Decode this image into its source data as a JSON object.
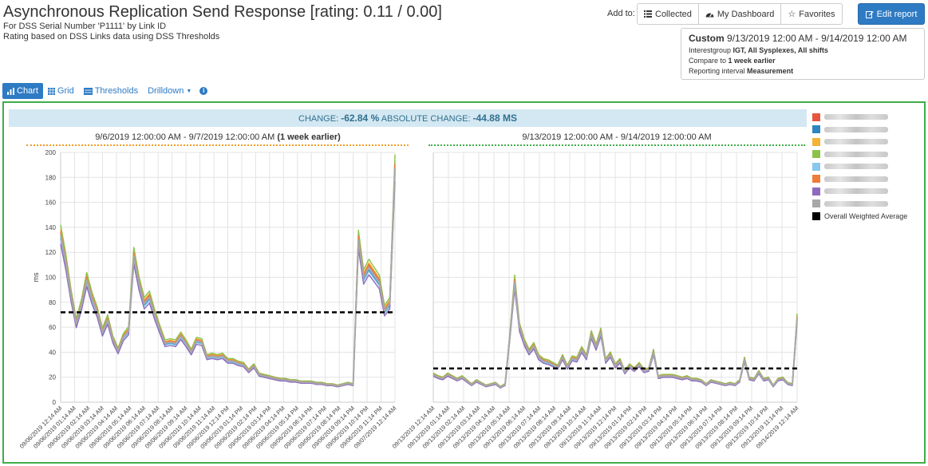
{
  "header": {
    "title": "Asynchronous Replication Send Response [rating: 0.11 / 0.00]",
    "subtitle1": "For DSS Serial Number 'P1111' by Link ID",
    "subtitle2": "Rating based on DSS Links data using DSS Thresholds"
  },
  "toolbar": {
    "add_to_label": "Add to:",
    "collected_label": "Collected",
    "dashboard_label": "My Dashboard",
    "favorites_label": "Favorites",
    "edit_label": "Edit report"
  },
  "info": {
    "range_prefix": "Custom",
    "range_value": "9/13/2019 12:00 AM - 9/14/2019 12:00 AM",
    "line1_prefix": "Interestgroup ",
    "line1_bold": "IGT, All Sysplexes, All shifts",
    "line2_prefix": "Compare to ",
    "line2_bold": "1 week earlier",
    "line3_prefix": "Reporting interval ",
    "line3_bold": "Measurement"
  },
  "tabs": {
    "chart": "Chart",
    "grid": "Grid",
    "thresholds": "Thresholds",
    "drilldown": "Drilldown"
  },
  "change": {
    "label": "CHANGE:",
    "value": "-62.84 %",
    "abs_label": "ABSOLUTE CHANGE:",
    "abs_value": "-44.88 MS"
  },
  "colors": {
    "accent": "#2e7bc4",
    "frame": "#3fae49",
    "left_rule": "#f39c2c",
    "right_rule": "#3fae49"
  },
  "legend": {
    "items": [
      {
        "color": "#e8553e",
        "label": ""
      },
      {
        "color": "#2e86c1",
        "label": ""
      },
      {
        "color": "#f5b335",
        "label": ""
      },
      {
        "color": "#8bc34a",
        "label": ""
      },
      {
        "color": "#87c7ee",
        "label": ""
      },
      {
        "color": "#f07c3a",
        "label": ""
      },
      {
        "color": "#8e6bbf",
        "label": ""
      },
      {
        "color": "#a8a8a8",
        "label": ""
      },
      {
        "color": "#000000",
        "label": "Overall Weighted Average"
      }
    ]
  },
  "chart_data": [
    {
      "type": "line",
      "title": "9/6/2019 12:00:00 AM - 9/7/2019 12:00:00 AM",
      "title_suffix": "(1 week earlier)",
      "ylabel": "ms",
      "ylim": [
        0,
        200
      ],
      "yticks": [
        0,
        20,
        40,
        60,
        80,
        100,
        120,
        140,
        160,
        180,
        200
      ],
      "grid": true,
      "x_tick_labels": [
        "09/06/2019 12:14 AM",
        "09/06/2019 01:14 AM",
        "09/06/2019 02:14 AM",
        "09/06/2019 03:14 AM",
        "09/06/2019 04:14 AM",
        "09/06/2019 05:14 AM",
        "09/06/2019 06:14 AM",
        "09/06/2019 07:14 AM",
        "09/06/2019 08:14 AM",
        "09/06/2019 09:14 AM",
        "09/06/2019 10:14 AM",
        "09/06/2019 11:14 AM",
        "09/06/2019 12:14 PM",
        "09/06/2019 01:14 PM",
        "09/06/2019 02:14 PM",
        "09/06/2019 03:14 PM",
        "09/06/2019 04:14 PM",
        "09/06/2019 05:14 PM",
        "09/06/2019 06:14 PM",
        "09/06/2019 07:14 PM",
        "09/06/2019 08:14 PM",
        "09/06/2019 09:14 PM",
        "09/06/2019 10:14 PM",
        "09/06/2019 11:14 PM",
        "09/07/2019 12:14 AM"
      ],
      "average": 72,
      "series_values": [
        134,
        112,
        85,
        63,
        78,
        98,
        83,
        72,
        56,
        66,
        50,
        41,
        52,
        57,
        117,
        95,
        79,
        84,
        70,
        58,
        47,
        48,
        47,
        53,
        47,
        40,
        49,
        48,
        36,
        37,
        36,
        37,
        33,
        33,
        31,
        30,
        25,
        29,
        22,
        21,
        20,
        19,
        18,
        18,
        17,
        17,
        16,
        16,
        16,
        15,
        15,
        14,
        14,
        13,
        14,
        15,
        14,
        130,
        100,
        108,
        102,
        96,
        73,
        79,
        187
      ]
    },
    {
      "type": "line",
      "title": "9/13/2019 12:00:00 AM - 9/14/2019 12:00:00 AM",
      "title_suffix": "",
      "ylabel": "",
      "ylim": [
        0,
        200
      ],
      "yticks": [
        0,
        20,
        40,
        60,
        80,
        100,
        120,
        140,
        160,
        180,
        200
      ],
      "grid": true,
      "x_tick_labels": [
        "09/13/2019 12:14 AM",
        "09/13/2019 01:14 AM",
        "09/13/2019 02:14 AM",
        "09/13/2019 03:14 AM",
        "09/13/2019 04:14 AM",
        "09/13/2019 05:14 AM",
        "09/13/2019 06:14 AM",
        "09/13/2019 07:14 AM",
        "09/13/2019 08:14 AM",
        "09/13/2019 09:14 AM",
        "09/13/2019 10:14 AM",
        "09/13/2019 11:14 AM",
        "09/13/2019 12:14 PM",
        "09/13/2019 01:14 PM",
        "09/13/2019 02:14 PM",
        "09/13/2019 03:14 PM",
        "09/13/2019 04:14 PM",
        "09/13/2019 05:14 PM",
        "09/13/2019 06:14 PM",
        "09/13/2019 07:14 PM",
        "09/13/2019 08:14 PM",
        "09/13/2019 09:14 PM",
        "09/13/2019 10:14 PM",
        "09/13/2019 11:14 PM",
        "09/14/2019 12:14 AM"
      ],
      "average": 27,
      "series_values": [
        22,
        20,
        19,
        22,
        20,
        18,
        20,
        17,
        14,
        17,
        15,
        13,
        14,
        15,
        12,
        14,
        53,
        96,
        60,
        48,
        40,
        45,
        36,
        33,
        32,
        30,
        28,
        36,
        28,
        35,
        34,
        42,
        36,
        54,
        44,
        56,
        33,
        38,
        29,
        33,
        24,
        29,
        26,
        30,
        25,
        26,
        40,
        20,
        21,
        21,
        21,
        20,
        19,
        20,
        18,
        18,
        17,
        14,
        17,
        16,
        15,
        14,
        15,
        14,
        17,
        34,
        19,
        18,
        24,
        18,
        19,
        13,
        18,
        19,
        15,
        14,
        67
      ]
    }
  ]
}
